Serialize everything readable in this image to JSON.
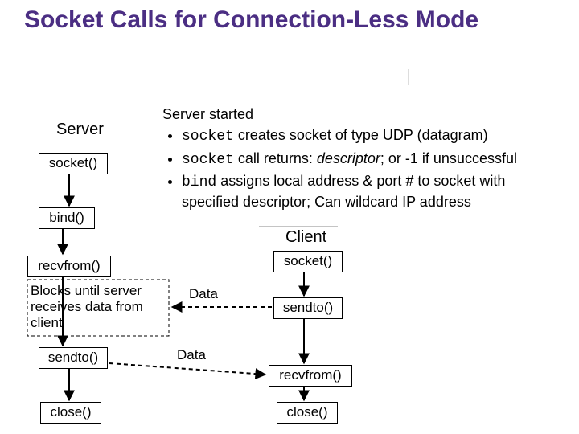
{
  "title": "Socket Calls for Connection-Less Mode",
  "server_label": "Server",
  "client_label": "Client",
  "server_boxes": {
    "socket": "socket()",
    "bind": "bind()",
    "recvfrom": "recvfrom()",
    "sendto": "sendto()",
    "close": "close()"
  },
  "client_boxes": {
    "socket": "socket()",
    "sendto": "sendto()",
    "recvfrom": "recvfrom()",
    "close": "close()"
  },
  "note_blocks": "Blocks until server receives data from client",
  "data_label_1": "Data",
  "data_label_2": "Data",
  "info": {
    "header": "Server started",
    "b1_a": "socket",
    "b1_b": " creates socket of type UDP (datagram)",
    "b2_a": "socket",
    "b2_b": " call returns:  ",
    "b2_c": "descriptor",
    "b2_d": ";  or -1 if unsuccessful",
    "b3_a": "bind",
    "b3_b": " assigns local address & port # to socket with specified descriptor; Can wildcard IP address"
  }
}
